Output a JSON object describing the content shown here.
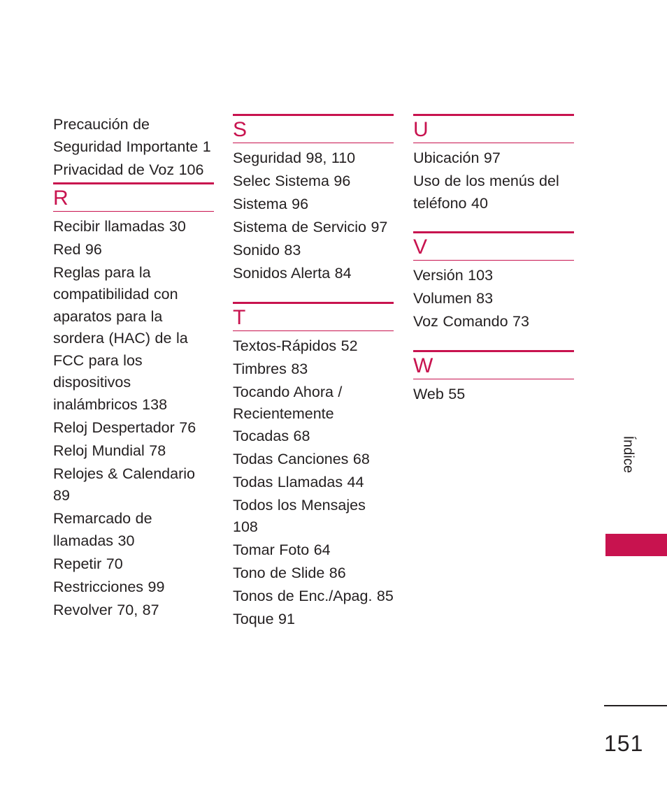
{
  "page": {
    "folio": "151",
    "side_tab_label": "Índice",
    "accent_color": "#c8134f",
    "text_color": "#231f20"
  },
  "columns": [
    {
      "name": "column-1",
      "lead_entries": [
        "Precaución de Seguridad Importante 1",
        "Privacidad de Voz 106"
      ],
      "sections": [
        {
          "letter": "R",
          "entries": [
            "Recibir llamadas 30",
            "Red 96",
            "Reglas para la compatibilidad con aparatos para la sordera (HAC) de la FCC para los dispositivos inalámbricos 138",
            "Reloj Despertador 76",
            "Reloj Mundial 78",
            "Relojes & Calendario 89",
            "Remarcado de llamadas 30",
            "Repetir 70",
            "Restricciones 99",
            "Revolver 70, 87"
          ]
        }
      ]
    },
    {
      "name": "column-2",
      "lead_entries": [],
      "sections": [
        {
          "letter": "S",
          "entries": [
            "Seguridad 98, 110",
            "Selec Sistema 96",
            "Sistema 96",
            "Sistema de Servicio 97",
            "Sonido 83",
            "Sonidos Alerta 84"
          ]
        },
        {
          "letter": "T",
          "entries": [
            "Textos-Rápidos 52",
            "Timbres 83",
            "Tocando Ahora / Recientemente Tocadas 68",
            "Todas Canciones 68",
            "Todas Llamadas 44",
            "Todos los Mensajes 108",
            "Tomar Foto 64",
            "Tono de Slide 86",
            "Tonos de Enc./Apag. 85",
            "Toque 91"
          ]
        }
      ]
    },
    {
      "name": "column-3",
      "lead_entries": [],
      "sections": [
        {
          "letter": "U",
          "entries": [
            "Ubicación 97",
            "Uso de los menús del teléfono 40"
          ]
        },
        {
          "letter": "V",
          "entries": [
            "Versión 103",
            "Volumen 83",
            "Voz Comando 73"
          ]
        },
        {
          "letter": "W",
          "entries": [
            "Web 55"
          ]
        }
      ]
    }
  ]
}
